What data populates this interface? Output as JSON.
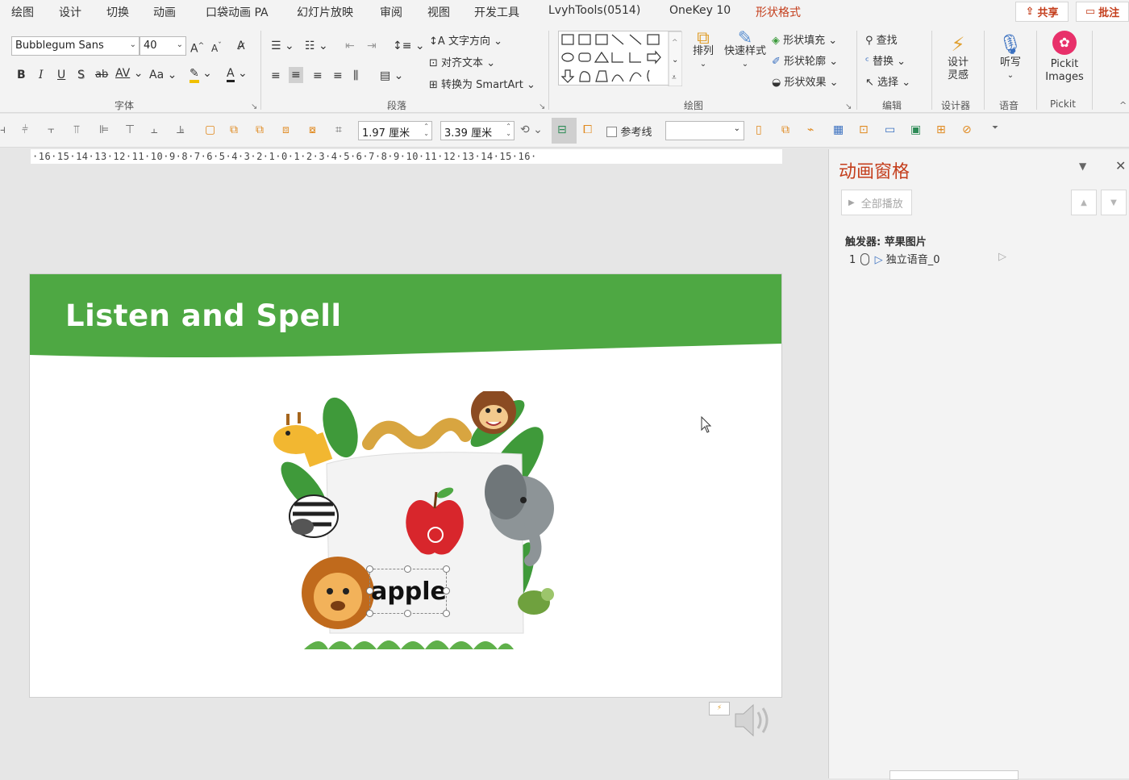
{
  "menu": {
    "tabs": [
      "绘图",
      "设计",
      "切换",
      "动画",
      "口袋动画 PA",
      "幻灯片放映",
      "审阅",
      "视图",
      "开发工具",
      "LvyhTools(0514)",
      "OneKey 10",
      "形状格式"
    ],
    "share": "共享",
    "comment": "批注"
  },
  "ribbon": {
    "font": {
      "name": "Bubblegum Sans",
      "size": "40",
      "label": "字体",
      "bold": "B",
      "italic": "I",
      "underline": "U",
      "shadow": "S",
      "strike": "ab",
      "spacing": "AV",
      "case": "Aa",
      "grow": "A",
      "shrink": "A",
      "color": "A"
    },
    "paragraph": {
      "label": "段落",
      "text_direction": "文字方向",
      "align_text": "对齐文本",
      "smartart": "转换为 SmartArt"
    },
    "drawing": {
      "label": "绘图",
      "arrange": "排列",
      "quick_styles": "快速样式",
      "fill": "形状填充",
      "outline": "形状轮廓",
      "effects": "形状效果"
    },
    "editing": {
      "label": "编辑",
      "find": "查找",
      "replace": "替换",
      "select": "选择"
    },
    "designer": {
      "label": "设计器",
      "button": "设计\n灵感"
    },
    "voice": {
      "label": "语音",
      "button": "听写"
    },
    "pickit": {
      "label": "Pickit",
      "button": "Pickit\nImages"
    }
  },
  "format_bar": {
    "height": "1.97 厘米",
    "width": "3.39 厘米",
    "guides": "参考线"
  },
  "ruler": "·16·15·14·13·12·11·10·9·8·7·6·5·4·3·2·1·0·1·2·3·4·5·6·7·8·9·10·11·12·13·14·15·16·",
  "slide": {
    "title": "Listen and Spell",
    "word": "apple",
    "banner_color": "#4ea843"
  },
  "pane": {
    "title": "动画窗格",
    "play_all": "全部播放",
    "trigger": "触发器: 苹果图片",
    "item_number": "1",
    "item_label": "独立语音_0"
  }
}
